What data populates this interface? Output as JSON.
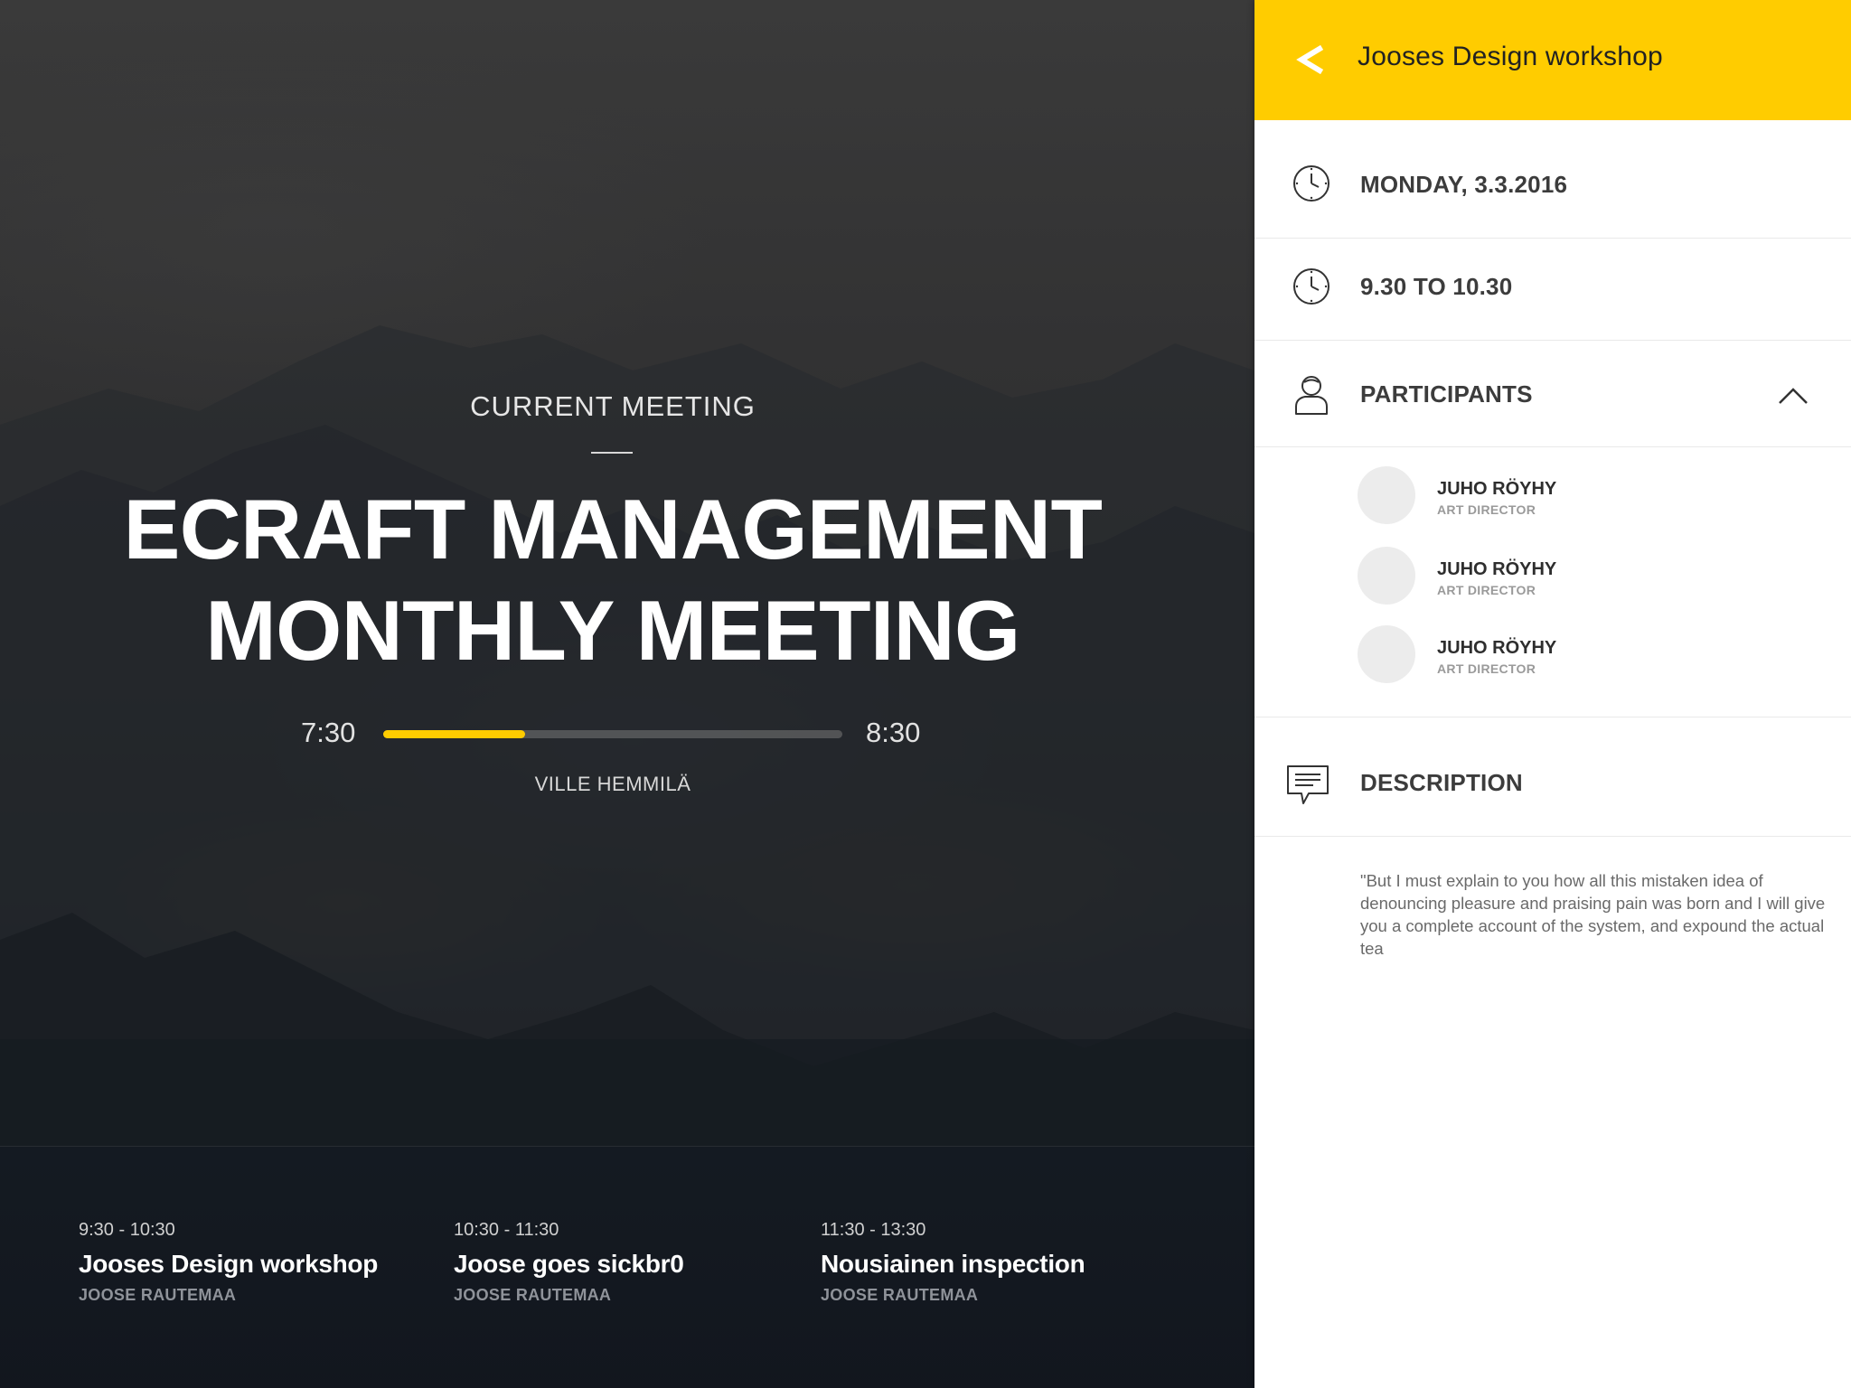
{
  "hero": {
    "current_label": "CURRENT MEETING",
    "title_line1": "ECRAFT MANAGEMENT",
    "title_line2": "MONTHLY MEETING",
    "start_time": "7:30",
    "end_time": "8:30",
    "progress_percent": 31,
    "organizer": "VILLE HEMMILÄ",
    "upcoming": [
      {
        "time": "9:30 - 10:30",
        "title": "Jooses Design workshop",
        "host": "JOOSE RAUTEMAA"
      },
      {
        "time": "10:30 - 11:30",
        "title": "Joose goes sickbr0",
        "host": "JOOSE RAUTEMAA"
      },
      {
        "time": "11:30 - 13:30",
        "title": "Nousiainen inspection",
        "host": "JOOSE RAUTEMAA"
      }
    ]
  },
  "panel": {
    "title": "Jooses Design workshop",
    "date": "MONDAY, 3.3.2016",
    "time_range": "9.30 TO 10.30",
    "participants_label": "PARTICIPANTS",
    "participants": [
      {
        "name": "JUHO RÖYHY",
        "role": "ART DIRECTOR"
      },
      {
        "name": "JUHO RÖYHY",
        "role": "ART DIRECTOR"
      },
      {
        "name": "JUHO RÖYHY",
        "role": "ART DIRECTOR"
      }
    ],
    "description_label": "DESCRIPTION",
    "description": "\"But I must explain to you how all this mistaken idea of denouncing pleasure and praising pain was born and I will give you a complete account of the system, and expound the actual tea"
  },
  "colors": {
    "accent": "#ffcc00",
    "panel_bg": "#ffffff",
    "hero_text": "#ffffff"
  },
  "icons": {
    "back": "chevron-left-icon",
    "date": "clock-icon",
    "time": "clock-icon",
    "participants": "person-icon",
    "collapse": "chevron-up-icon",
    "description": "speech-bubble-icon"
  }
}
